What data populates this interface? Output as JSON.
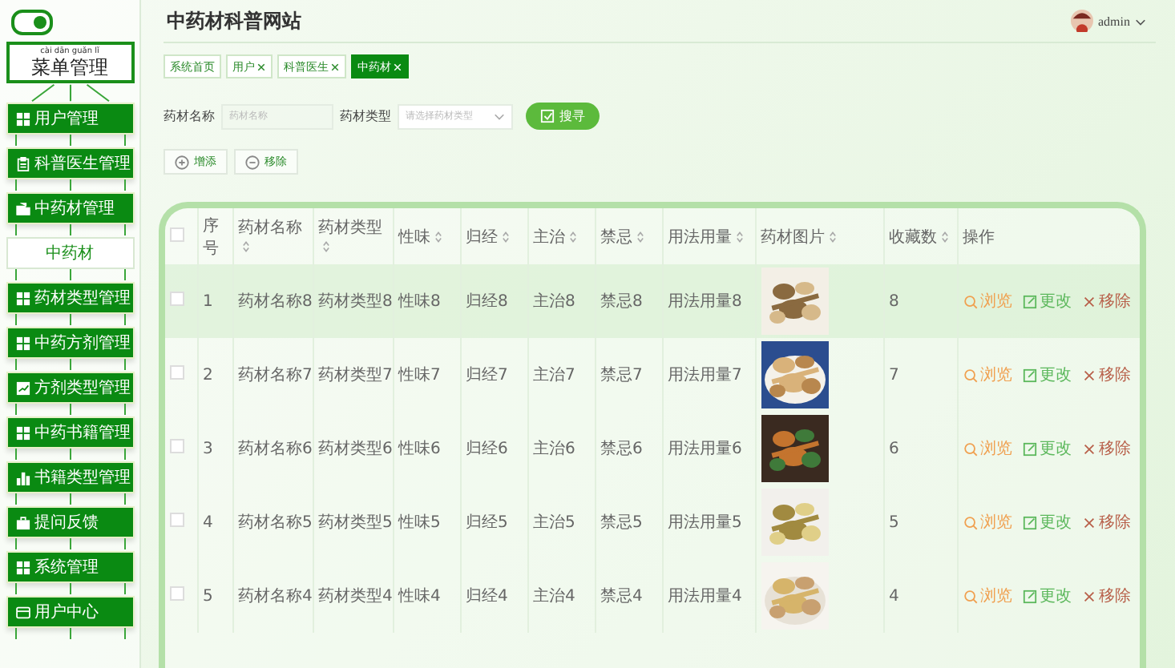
{
  "sidebar": {
    "toggle": {
      "on": true
    },
    "title": "菜单管理",
    "title_pinyin": "cài dān guǎn lǐ",
    "items": [
      {
        "label": "用户管理",
        "kind": "menu",
        "selected": false
      },
      {
        "label": "科普医生管理",
        "kind": "menu",
        "selected": false
      },
      {
        "label": "中药材管理",
        "kind": "menu",
        "selected": false
      },
      {
        "label": "中药材",
        "kind": "submenu",
        "selected": true
      },
      {
        "label": "药材类型管理",
        "kind": "menu",
        "selected": false
      },
      {
        "label": "中药方剂管理",
        "kind": "menu",
        "selected": false
      },
      {
        "label": "方剂类型管理",
        "kind": "menu",
        "selected": false
      },
      {
        "label": "中药书籍管理",
        "kind": "menu",
        "selected": false
      },
      {
        "label": "书籍类型管理",
        "kind": "menu",
        "selected": false
      },
      {
        "label": "提问反馈",
        "kind": "menu",
        "selected": false
      },
      {
        "label": "系统管理",
        "kind": "menu",
        "selected": false
      },
      {
        "label": "用户中心",
        "kind": "menu",
        "selected": false
      }
    ]
  },
  "header": {
    "title": "中药材科普网站",
    "user": "admin"
  },
  "tabs": [
    {
      "label": "系统首页",
      "closable": false,
      "selected": false
    },
    {
      "label": "用户",
      "closable": true,
      "selected": false
    },
    {
      "label": "科普医生",
      "closable": true,
      "selected": false
    },
    {
      "label": "中药材",
      "closable": true,
      "selected": true
    }
  ],
  "search": {
    "fields": [
      {
        "label": "药材名称",
        "kind": "text",
        "placeholder": "药材名称"
      },
      {
        "label": "药材类型",
        "kind": "select",
        "placeholder": "请选择药材类型"
      }
    ],
    "button": "搜寻"
  },
  "actions": [
    {
      "label": "增添",
      "kind": "add"
    },
    {
      "label": "移除",
      "kind": "remove"
    }
  ],
  "table": {
    "select_all": {
      "checked": false
    },
    "columns": [
      {
        "label": "序号",
        "sortable": false
      },
      {
        "label": "药材名称",
        "sortable": true
      },
      {
        "label": "药材类型",
        "sortable": true
      },
      {
        "label": "性味",
        "sortable": true
      },
      {
        "label": "归经",
        "sortable": true
      },
      {
        "label": "主治",
        "sortable": true
      },
      {
        "label": "禁忌",
        "sortable": true
      },
      {
        "label": "用法用量",
        "sortable": true
      },
      {
        "label": "药材图片",
        "sortable": true
      },
      {
        "label": "收藏数",
        "sortable": true
      },
      {
        "label": "操作",
        "sortable": false
      }
    ],
    "rows": [
      {
        "checked": false,
        "highlighted": true,
        "cells": [
          "1",
          "药材名称8",
          "药材类型8",
          "性味8",
          "归经8",
          "主治8",
          "禁忌8",
          "用法用量8"
        ],
        "picture": {
          "kind": "picture"
        },
        "favorites": "8",
        "actions": [
          {
            "label": "浏览",
            "kind": "view"
          },
          {
            "label": "更改",
            "kind": "edit"
          },
          {
            "label": "移除",
            "kind": "delete"
          }
        ]
      },
      {
        "checked": false,
        "highlighted": false,
        "cells": [
          "2",
          "药材名称7",
          "药材类型7",
          "性味7",
          "归经7",
          "主治7",
          "禁忌7",
          "用法用量7"
        ],
        "picture": {
          "kind": "picture"
        },
        "favorites": "7",
        "actions": [
          {
            "label": "浏览",
            "kind": "view"
          },
          {
            "label": "更改",
            "kind": "edit"
          },
          {
            "label": "移除",
            "kind": "delete"
          }
        ]
      },
      {
        "checked": false,
        "highlighted": false,
        "cells": [
          "3",
          "药材名称6",
          "药材类型6",
          "性味6",
          "归经6",
          "主治6",
          "禁忌6",
          "用法用量6"
        ],
        "picture": {
          "kind": "picture"
        },
        "favorites": "6",
        "actions": [
          {
            "label": "浏览",
            "kind": "view"
          },
          {
            "label": "更改",
            "kind": "edit"
          },
          {
            "label": "移除",
            "kind": "delete"
          }
        ]
      },
      {
        "checked": false,
        "highlighted": false,
        "cells": [
          "4",
          "药材名称5",
          "药材类型5",
          "性味5",
          "归经5",
          "主治5",
          "禁忌5",
          "用法用量5"
        ],
        "picture": {
          "kind": "picture"
        },
        "favorites": "5",
        "actions": [
          {
            "label": "浏览",
            "kind": "view"
          },
          {
            "label": "更改",
            "kind": "edit"
          },
          {
            "label": "移除",
            "kind": "delete"
          }
        ]
      },
      {
        "checked": false,
        "highlighted": false,
        "cells": [
          "5",
          "药材名称4",
          "药材类型4",
          "性味4",
          "归经4",
          "主治4",
          "禁忌4",
          "用法用量4"
        ],
        "picture": {
          "kind": "picture"
        },
        "favorites": "4",
        "actions": [
          {
            "label": "浏览",
            "kind": "view"
          },
          {
            "label": "更改",
            "kind": "edit"
          },
          {
            "label": "移除",
            "kind": "delete"
          }
        ]
      }
    ]
  }
}
